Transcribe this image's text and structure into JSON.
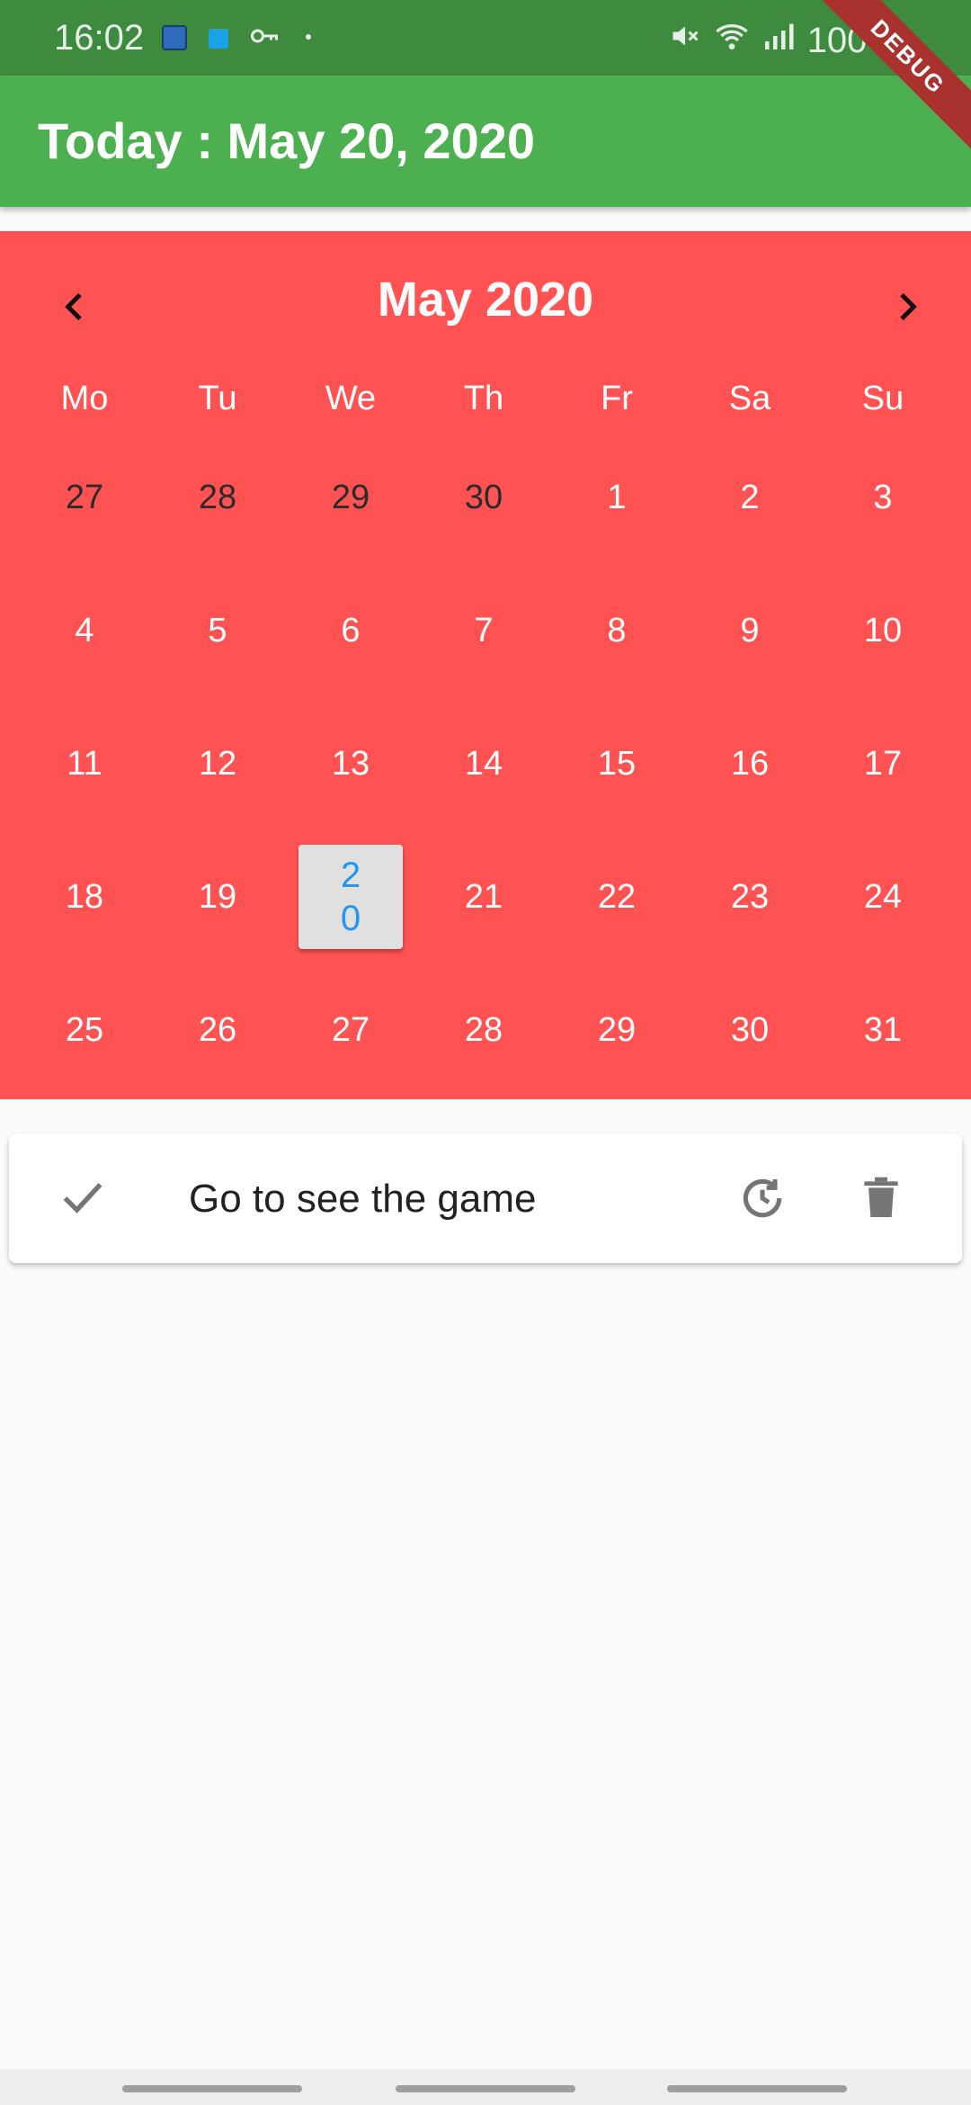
{
  "status_bar": {
    "time": "16:02",
    "battery": "100%",
    "debug_ribbon": "DEBUG",
    "icons": [
      "notes-icon",
      "store-icon",
      "key-icon",
      "dot-icon",
      "mute-icon",
      "wifi-icon",
      "signal-icon",
      "battery-icon"
    ]
  },
  "app_bar": {
    "title": "Today : May 20, 2020"
  },
  "calendar": {
    "month_title": "May 2020",
    "weekdays": [
      "Mo",
      "Tu",
      "We",
      "Th",
      "Fr",
      "Sa",
      "Su"
    ],
    "days": [
      "27",
      "28",
      "29",
      "30",
      "1",
      "2",
      "3",
      "4",
      "5",
      "6",
      "7",
      "8",
      "9",
      "10",
      "11",
      "12",
      "13",
      "14",
      "15",
      "16",
      "17",
      "18",
      "19",
      "20",
      "21",
      "22",
      "23",
      "24",
      "25",
      "26",
      "27",
      "28",
      "29",
      "30",
      "31"
    ],
    "selected_day": "20",
    "colors": {
      "background": "#ff5252",
      "selected": "#2196f3"
    }
  },
  "tasks": [
    {
      "label": "Go to see the game"
    }
  ],
  "colors": {
    "app_bar": "#4caf50",
    "status_bar": "#3e8a3e"
  }
}
